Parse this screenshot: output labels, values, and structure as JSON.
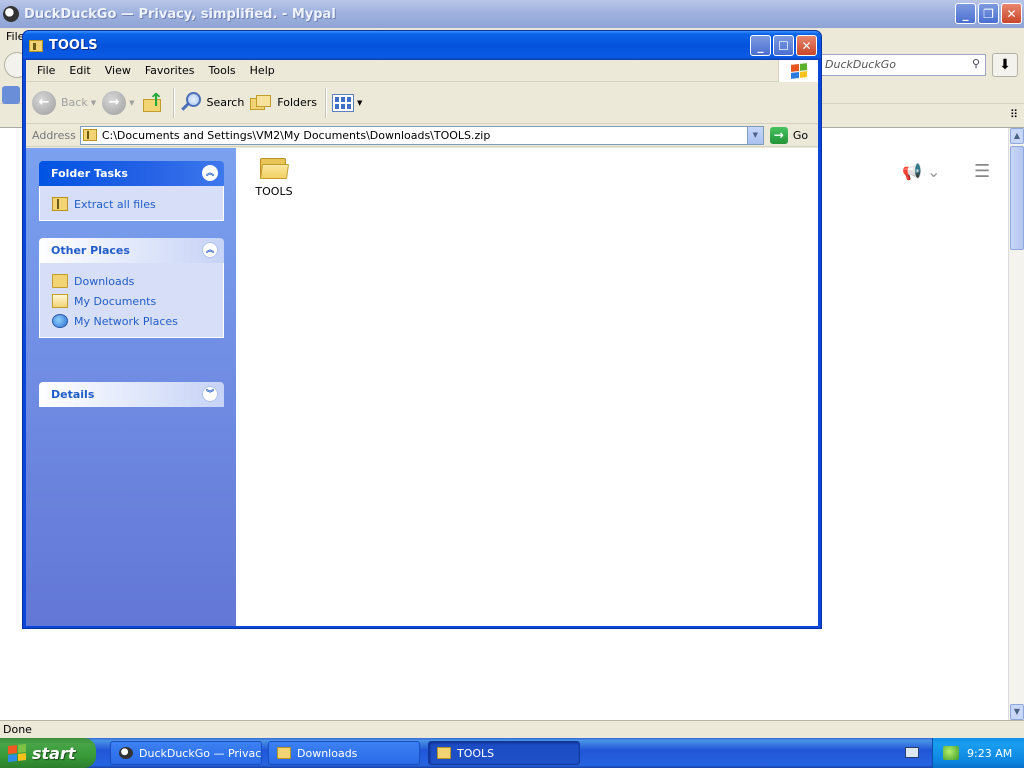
{
  "browser": {
    "window_title": "DuckDuckGo — Privacy, simplified. - Mypal",
    "menu_first": "File",
    "search_placeholder": "DuckDuckGo",
    "status": "Done"
  },
  "explorer": {
    "title": "TOOLS",
    "menu": [
      "File",
      "Edit",
      "View",
      "Favorites",
      "Tools",
      "Help"
    ],
    "toolbar": {
      "back": "Back",
      "search": "Search",
      "folders": "Folders"
    },
    "address": {
      "label": "Address",
      "value": "C:\\Documents and Settings\\VM2\\My Documents\\Downloads\\TOOLS.zip",
      "go": "Go"
    },
    "tasks": {
      "folder_tasks": {
        "title": "Folder Tasks",
        "items": [
          "Extract all files"
        ]
      },
      "other_places": {
        "title": "Other Places",
        "items": [
          "Downloads",
          "My Documents",
          "My Network Places"
        ]
      },
      "details": {
        "title": "Details"
      }
    },
    "files": [
      {
        "name": "TOOLS",
        "icon": "folder-icon"
      }
    ]
  },
  "taskbar": {
    "start": "start",
    "buttons": [
      {
        "label": "DuckDuckGo — Privac...",
        "icon": "duckduckgo-icon",
        "active": false
      },
      {
        "label": "Downloads",
        "icon": "folder-icon",
        "active": false
      },
      {
        "label": "TOOLS",
        "icon": "zip-folder-icon",
        "active": true
      }
    ],
    "clock": "9:23 AM"
  }
}
